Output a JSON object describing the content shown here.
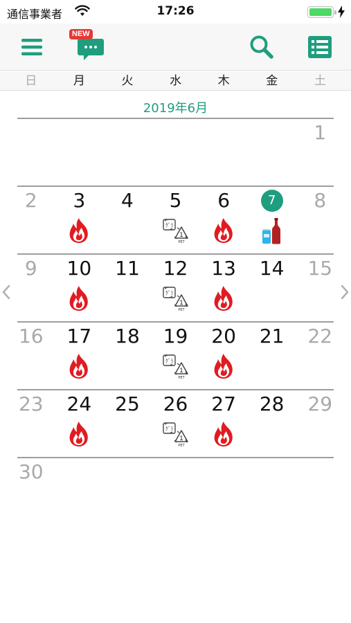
{
  "status_bar": {
    "carrier": "通信事業者",
    "time": "17:26",
    "battery_level": 1.0
  },
  "toolbar": {
    "new_badge": "NEW",
    "icons": [
      "menu-icon",
      "chat-icon",
      "search-icon",
      "list-icon"
    ],
    "accent_color": "#1e9e7e"
  },
  "weekdays": [
    "日",
    "月",
    "火",
    "水",
    "木",
    "金",
    "土"
  ],
  "month_title": "2019年6月",
  "today": 7,
  "weeks": [
    [
      null,
      null,
      null,
      null,
      null,
      null,
      {
        "day": 1,
        "dim": true,
        "icons": []
      }
    ],
    [
      {
        "day": 2,
        "dim": true,
        "icons": []
      },
      {
        "day": 3,
        "icons": [
          "burnable-fire-icon"
        ]
      },
      {
        "day": 4,
        "icons": []
      },
      {
        "day": 5,
        "icons": [
          "recycle-paper-pet-icon"
        ]
      },
      {
        "day": 6,
        "icons": [
          "burnable-fire-icon"
        ]
      },
      {
        "day": 7,
        "today": true,
        "icons": [
          "can-bottle-icon"
        ]
      },
      {
        "day": 8,
        "dim": true,
        "icons": []
      }
    ],
    [
      {
        "day": 9,
        "dim": true,
        "icons": []
      },
      {
        "day": 10,
        "icons": [
          "burnable-fire-icon"
        ]
      },
      {
        "day": 11,
        "icons": []
      },
      {
        "day": 12,
        "icons": [
          "recycle-paper-pet-icon"
        ]
      },
      {
        "day": 13,
        "icons": [
          "burnable-fire-icon"
        ]
      },
      {
        "day": 14,
        "icons": []
      },
      {
        "day": 15,
        "dim": true,
        "icons": []
      }
    ],
    [
      {
        "day": 16,
        "dim": true,
        "icons": []
      },
      {
        "day": 17,
        "icons": [
          "burnable-fire-icon"
        ]
      },
      {
        "day": 18,
        "icons": []
      },
      {
        "day": 19,
        "icons": [
          "recycle-paper-pet-icon"
        ]
      },
      {
        "day": 20,
        "icons": [
          "burnable-fire-icon"
        ]
      },
      {
        "day": 21,
        "icons": []
      },
      {
        "day": 22,
        "dim": true,
        "icons": []
      }
    ],
    [
      {
        "day": 23,
        "dim": true,
        "icons": []
      },
      {
        "day": 24,
        "icons": [
          "burnable-fire-icon"
        ]
      },
      {
        "day": 25,
        "icons": []
      },
      {
        "day": 26,
        "icons": [
          "recycle-paper-pet-icon"
        ]
      },
      {
        "day": 27,
        "icons": [
          "burnable-fire-icon"
        ]
      },
      {
        "day": 28,
        "icons": []
      },
      {
        "day": 29,
        "dim": true,
        "icons": []
      }
    ],
    [
      {
        "day": 30,
        "dim": true,
        "icons": []
      }
    ]
  ],
  "icon_labels": {
    "paper": "ｸﾞﾗ",
    "pet_number": "1",
    "pet": "PET"
  }
}
